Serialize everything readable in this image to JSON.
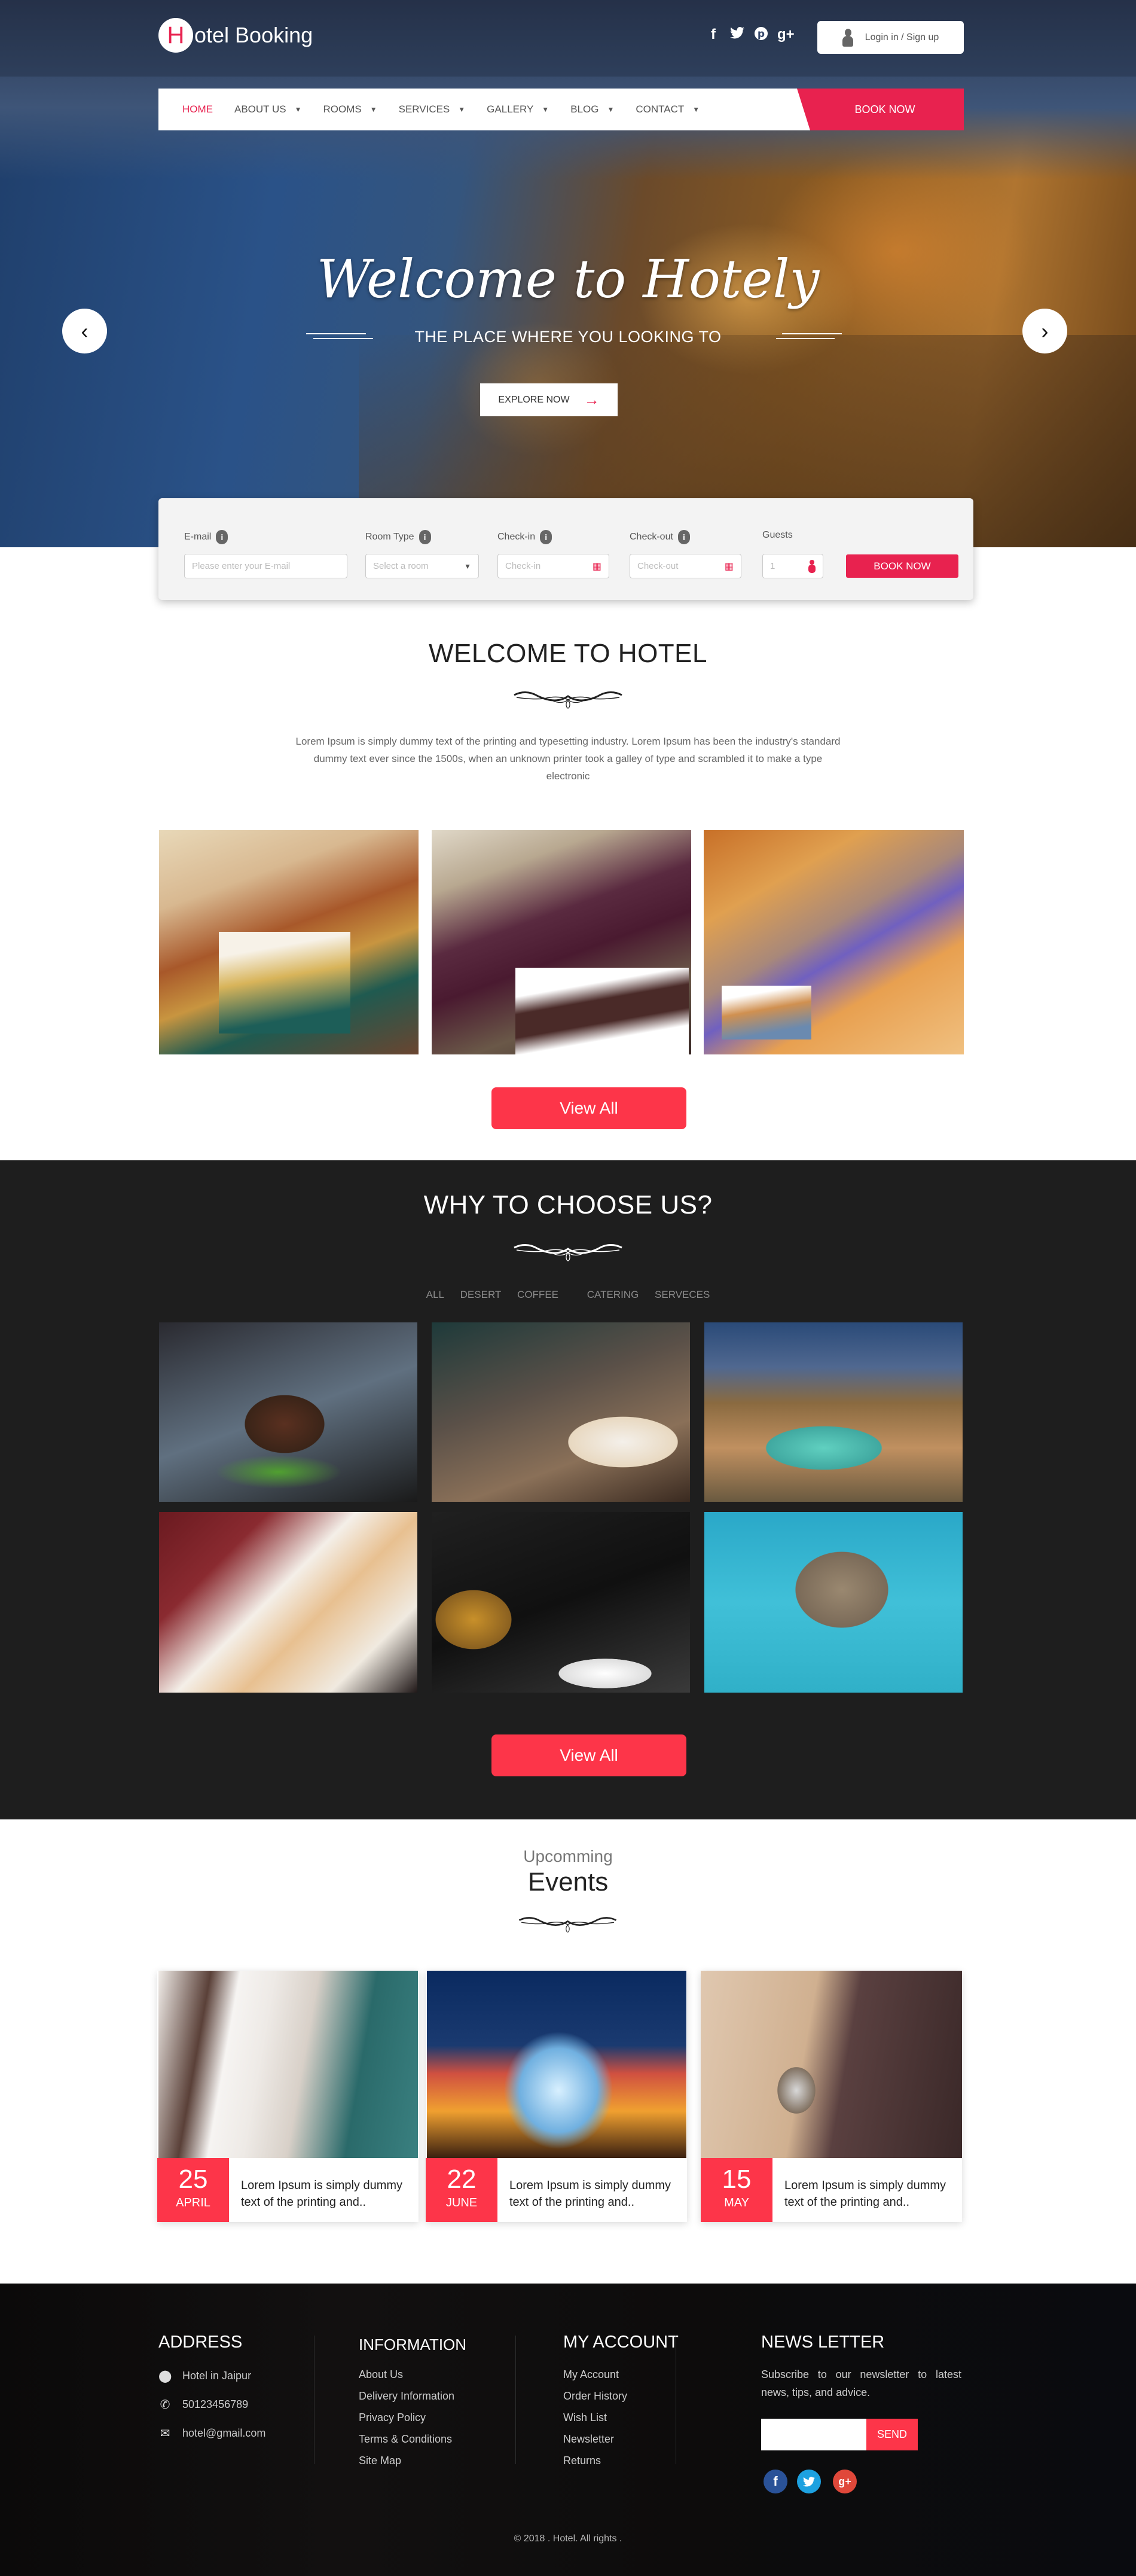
{
  "header": {
    "logo_letter": "H",
    "logo_text": "otel Booking",
    "social": [
      "f",
      "t",
      "p",
      "g+"
    ],
    "social_names": [
      "facebook",
      "twitter",
      "pinterest",
      "google-plus"
    ],
    "login_label": "Login in / Sign up"
  },
  "nav": {
    "items": [
      {
        "label": "HOME",
        "active": true,
        "dropdown": false
      },
      {
        "label": "ABOUT US",
        "active": false,
        "dropdown": true
      },
      {
        "label": "ROOMS",
        "active": false,
        "dropdown": true
      },
      {
        "label": "SERVICES",
        "active": false,
        "dropdown": true
      },
      {
        "label": "GALLERY",
        "active": false,
        "dropdown": true
      },
      {
        "label": "BLOG",
        "active": false,
        "dropdown": true
      },
      {
        "label": "CONTACT",
        "active": false,
        "dropdown": true
      }
    ],
    "book_now": "BOOK NOW"
  },
  "hero": {
    "title": "Welcome to Hotely",
    "subtitle": "THE PLACE WHERE YOU LOOKING TO",
    "cta": "EXPLORE NOW",
    "prev_icon": "‹",
    "next_icon": "›"
  },
  "booking": {
    "email_label": "E-mail",
    "email_placeholder": "Please enter your E-mail",
    "room_label": "Room Type",
    "room_value": "Select a room",
    "checkin_label": "Check-in",
    "checkin_placeholder": "Check-in",
    "checkout_label": "Check-out",
    "checkout_placeholder": "Check-out",
    "guests_label": "Guests",
    "guests_value": "1",
    "submit": "BOOK NOW"
  },
  "welcome": {
    "title": "WELCOME TO HOTEL",
    "text": "Lorem Ipsum is simply dummy text of the printing and typesetting industry. Lorem Ipsum has been the industry's standard dummy text ever since the 1500s, when an unknown printer took a galley of type and scrambled it to make a type electronic",
    "images": [
      "hotel-room-gold-bed",
      "hotel-room-twin-beds-purple",
      "hotel-room-orange-modern"
    ],
    "view_all": "View All"
  },
  "why": {
    "title": "WHY TO CHOOSE US?",
    "filters": [
      "ALL",
      "DESERT",
      "COFFEE",
      "CATERING",
      "SERVECES"
    ],
    "images": [
      "steak-plating",
      "fish-dinner-wine",
      "resort-pool-night",
      "seafood-platter",
      "chef-pouring-sauce",
      "overwater-villa"
    ],
    "view_all": "View All"
  },
  "events": {
    "kicker": "Upcomming",
    "title": "Events",
    "items": [
      {
        "day": "25",
        "month": "APRIL",
        "text": "Lorem Ipsum is simply dummy text of the printing and..",
        "image": "modern-suite"
      },
      {
        "day": "22",
        "month": "JUNE",
        "text": "Lorem Ipsum is simply dummy text of the printing and..",
        "image": "rooftop-dome-party"
      },
      {
        "day": "15",
        "month": "MAY",
        "text": "Lorem Ipsum is simply dummy text of the printing and..",
        "image": "reception-bell"
      }
    ]
  },
  "footer": {
    "address_title": "ADDRESS",
    "address": [
      {
        "icon": "map-pin",
        "text": "Hotel in Jaipur"
      },
      {
        "icon": "phone",
        "text": "50123456789"
      },
      {
        "icon": "mail",
        "text": "hotel@gmail.com"
      }
    ],
    "info_title": "INFORMATION",
    "info_links": [
      "About Us",
      "Delivery Information",
      "Privacy Policy",
      "Terms & Conditions",
      "Site Map"
    ],
    "account_title": "MY ACCOUNT",
    "account_links": [
      "My Account",
      "Order History",
      "Wish List",
      "Newsletter",
      "Returns"
    ],
    "newsletter_title": "NEWS LETTER",
    "newsletter_text": "Subscribe to our newsletter to latest news, tips, and advice.",
    "newsletter_input": "",
    "send": "SEND",
    "social": [
      "f",
      "t",
      "g+"
    ],
    "copyright": "© 2018 . Hotel. All rights ."
  },
  "colors": {
    "accent": "#e8224f",
    "button_red": "#fd3549",
    "dark_bg": "#1e1e1e",
    "footer_bg": "#0c0b0b",
    "form_bg": "#f3f3f3"
  }
}
